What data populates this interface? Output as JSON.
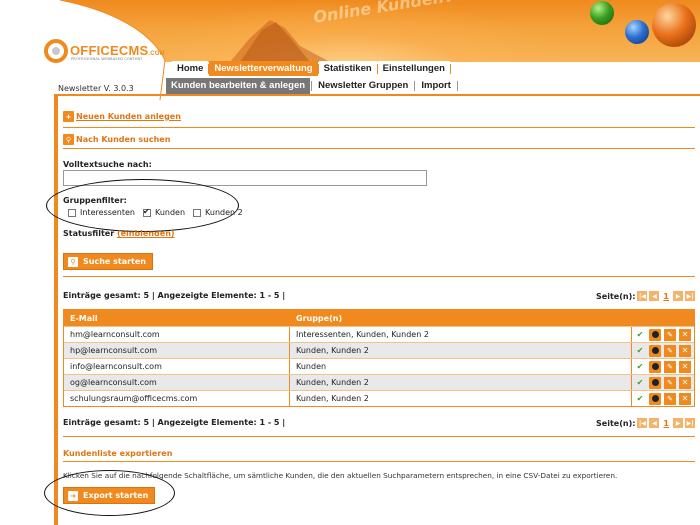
{
  "header": {
    "title": "Online Kundenverwaltung",
    "logo_text": "OFFICECMS",
    "logo_suffix": ".COM",
    "logo_sub": "PROFESSIONAL WEBBASED CONTENT",
    "version": "Newsletter V. 3.0.3"
  },
  "nav_main": [
    "Home",
    "Newsletterverwaltung",
    "Statistiken",
    "Einstellungen"
  ],
  "nav_sub": [
    "Kunden bearbeiten & anlegen",
    "Newsletter Gruppen",
    "Import"
  ],
  "actions": {
    "new_customer": "Neuen Kunden anlegen",
    "search_customer": "Nach Kunden suchen"
  },
  "search": {
    "fulltext_label": "Volltextsuche nach:",
    "fulltext_value": "",
    "group_filter_label": "Gruppenfilter:",
    "groups": [
      {
        "label": "Interessenten",
        "checked": false
      },
      {
        "label": "Kunden",
        "checked": true
      },
      {
        "label": "Kunden 2",
        "checked": false
      }
    ],
    "status_filter_label": "Statusfilter",
    "status_filter_link": "(einblenden)",
    "search_button": "Suche starten"
  },
  "paging": {
    "summary": "Einträge gesamt: 5  |  Angezeigte Elemente: 1 - 5  |",
    "pages_label": "Seite(n):",
    "current_page": "1"
  },
  "table": {
    "headers": [
      "E-Mail",
      "Gruppe(n)"
    ],
    "rows": [
      {
        "email": "hm@learnconsult.com",
        "groups": "Interessenten, Kunden, Kunden 2"
      },
      {
        "email": "hp@learnconsult.com",
        "groups": "Kunden, Kunden 2"
      },
      {
        "email": "info@learnconsult.com",
        "groups": "Kunden"
      },
      {
        "email": "og@learnconsult.com",
        "groups": "Kunden, Kunden 2"
      },
      {
        "email": "schulungsraum@officecms.com",
        "groups": "Kunden, Kunden 2"
      }
    ]
  },
  "export": {
    "title": "Kundenliste exportieren",
    "description": "Klicken Sie auf die nachfolgende Schaltfläche, um sämtliche Kunden, die den aktuellen Suchparametern entsprechen, in eine CSV-Datei zu exportieren.",
    "button": "Export starten"
  },
  "colors": {
    "accent": "#f08a1e",
    "active_sub": "#777777",
    "check": "#3aa02a"
  }
}
